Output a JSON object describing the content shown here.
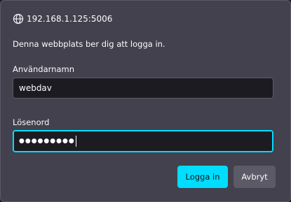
{
  "dialog": {
    "origin": "192.168.1.125:5006",
    "origin_icon": "globe-icon",
    "message": "Denna webbplats ber dig att logga in."
  },
  "username": {
    "label": "Användarnamn",
    "value": "webdav"
  },
  "password": {
    "label": "Lösenord",
    "masked_value": "●●●●●●●●●"
  },
  "buttons": {
    "login": "Logga in",
    "cancel": "Avbryt"
  },
  "colors": {
    "accent": "#00ddff",
    "dialog_bg": "#42414d",
    "field_bg": "#1c1b22",
    "text": "#fbfbfe"
  }
}
